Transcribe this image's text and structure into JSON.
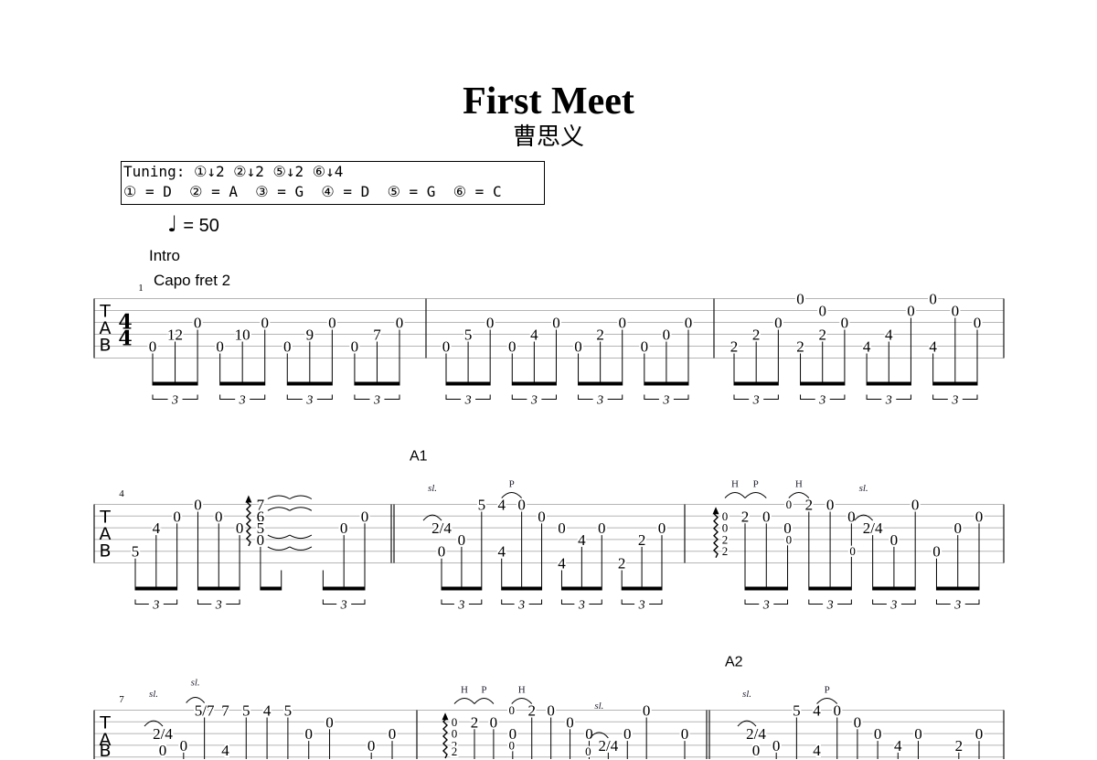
{
  "title": "First Meet",
  "artist": "曹思义",
  "tuning": {
    "line1": "Tuning: ①↓2 ②↓2 ⑤↓2 ⑥↓4",
    "line2": "① = D  ② = A  ③ = G  ④ = D  ⑤ = G  ⑥ = C"
  },
  "tempo": {
    "symbol": "♩",
    "text": "= 50"
  },
  "intro_label": "Intro",
  "capo": "Capo fret 2",
  "tab_clef": [
    "T",
    "A",
    "B"
  ],
  "time_signature": {
    "top": "4",
    "bottom": "4"
  },
  "triplet_label": "3",
  "systems": [
    {
      "measure_number": "1",
      "measures": [
        {
          "slots": [
            [
              [
                5,
                "0"
              ]
            ],
            [
              [
                4,
                "12"
              ]
            ],
            [
              [
                3,
                "0"
              ]
            ],
            [
              [
                5,
                "0"
              ]
            ],
            [
              [
                4,
                "10"
              ]
            ],
            [
              [
                3,
                "0"
              ]
            ],
            [
              [
                5,
                "0"
              ]
            ],
            [
              [
                4,
                "9"
              ]
            ],
            [
              [
                3,
                "0"
              ]
            ],
            [
              [
                5,
                "0"
              ]
            ],
            [
              [
                4,
                "7"
              ]
            ],
            [
              [
                3,
                "0"
              ]
            ]
          ]
        },
        {
          "slots": [
            [
              [
                5,
                "0"
              ]
            ],
            [
              [
                4,
                "5"
              ]
            ],
            [
              [
                3,
                "0"
              ]
            ],
            [
              [
                5,
                "0"
              ]
            ],
            [
              [
                4,
                "4"
              ]
            ],
            [
              [
                3,
                "0"
              ]
            ],
            [
              [
                5,
                "0"
              ]
            ],
            [
              [
                4,
                "2"
              ]
            ],
            [
              [
                3,
                "0"
              ]
            ],
            [
              [
                5,
                "0"
              ]
            ],
            [
              [
                4,
                "0"
              ]
            ],
            [
              [
                3,
                "0"
              ]
            ]
          ]
        },
        {
          "slots": [
            [
              [
                5,
                "2"
              ]
            ],
            [
              [
                4,
                "2"
              ]
            ],
            [
              [
                3,
                "0"
              ]
            ],
            [
              [
                1,
                "0"
              ],
              [
                5,
                "2"
              ]
            ],
            [
              [
                2,
                "0"
              ],
              [
                4,
                "2"
              ]
            ],
            [
              [
                3,
                "0"
              ]
            ],
            [
              [
                5,
                "4"
              ]
            ],
            [
              [
                4,
                "4"
              ]
            ],
            [
              [
                2,
                "0"
              ]
            ],
            [
              [
                1,
                "0"
              ],
              [
                5,
                "4"
              ]
            ],
            [
              [
                2,
                "0"
              ]
            ],
            [
              [
                3,
                "0"
              ]
            ]
          ]
        }
      ]
    },
    {
      "measure_number": "4",
      "measures": [
        {
          "slots": [
            [
              [
                5,
                "5"
              ]
            ],
            [
              [
                3,
                "4"
              ]
            ],
            [
              [
                2,
                "0"
              ]
            ],
            [
              [
                1,
                "0"
              ]
            ],
            [
              [
                2,
                "0"
              ]
            ],
            [
              [
                3,
                "0"
              ]
            ],
            {
              "n": [
                [
                  1,
                  "7"
                ],
                [
                  2,
                  "6"
                ],
                [
                  3,
                  "5"
                ],
                [
                  4,
                  "0"
                ]
              ],
              "arp": true,
              "ring": true
            },
            [],
            null,
            [],
            [
              [
                3,
                "0"
              ]
            ],
            [
              [
                2,
                "0"
              ]
            ]
          ],
          "triplets": [
            true,
            true,
            false,
            true
          ]
        },
        {
          "section": "A1",
          "slots": [
            [
              [
                3,
                "2/4"
              ],
              [
                5,
                "0"
              ]
            ],
            [
              [
                4,
                "0"
              ]
            ],
            [
              [
                1,
                "5"
              ]
            ],
            [
              [
                1,
                "4"
              ],
              [
                5,
                "4"
              ]
            ],
            [
              [
                1,
                "0"
              ]
            ],
            [
              [
                2,
                "0"
              ]
            ],
            [
              [
                3,
                "0"
              ],
              [
                6,
                "4"
              ]
            ],
            [
              [
                4,
                "4"
              ]
            ],
            [
              [
                3,
                "0"
              ]
            ],
            [
              [
                6,
                "2"
              ]
            ],
            [
              [
                4,
                "2"
              ]
            ],
            [
              [
                3,
                "0"
              ]
            ]
          ],
          "techs": [
            {
              "at": 0,
              "label": "sl."
            },
            {
              "at": 4,
              "label": "P"
            }
          ]
        },
        {
          "slots": [
            {
              "pre": [
                [
                  2,
                  "0"
                ],
                [
                  3,
                  "0"
                ],
                [
                  4,
                  "2"
                ],
                [
                  5,
                  "2"
                ]
              ],
              "arp": true,
              "n": [
                [
                  2,
                  "2"
                ]
              ]
            },
            [
              [
                2,
                "0"
              ]
            ],
            [
              [
                3,
                "0"
              ]
            ],
            {
              "pre": [
                [
                  1,
                  "0"
                ],
                [
                  4,
                  "0"
                ]
              ],
              "n": [
                [
                  1,
                  "2"
                ]
              ]
            },
            [
              [
                1,
                "0"
              ]
            ],
            [
              [
                2,
                "0"
              ]
            ],
            {
              "pre": [
                [
                  5,
                  "0"
                ]
              ],
              "n": [
                [
                  3,
                  "2/4"
                ]
              ]
            },
            [
              [
                4,
                "0"
              ]
            ],
            [
              [
                1,
                "0"
              ]
            ],
            [
              [
                5,
                "0"
              ]
            ],
            [
              [
                3,
                "0"
              ]
            ],
            [
              [
                2,
                "0"
              ]
            ]
          ],
          "techs": [
            {
              "at": 0,
              "label": "H"
            },
            {
              "at": 1,
              "label": "P"
            },
            {
              "at": 3,
              "label": "H"
            },
            {
              "at": 6,
              "label": "sl."
            }
          ]
        }
      ]
    },
    {
      "measure_number": "7",
      "measures": [
        {
          "slots": [
            [
              [
                3,
                "2/4"
              ],
              [
                5,
                "0"
              ]
            ],
            [
              [
                4,
                "0"
              ]
            ],
            [
              [
                1,
                "5/7"
              ]
            ],
            [
              [
                1,
                "7"
              ],
              [
                5,
                "4"
              ]
            ],
            [
              [
                1,
                "5"
              ]
            ],
            [
              [
                1,
                "4"
              ]
            ],
            [
              [
                1,
                "5"
              ]
            ],
            [
              [
                3,
                "0"
              ]
            ],
            [
              [
                2,
                "0"
              ]
            ],
            null,
            [
              [
                4,
                "0"
              ]
            ],
            [
              [
                3,
                "0"
              ]
            ]
          ],
          "techs": [
            {
              "at": 0,
              "label": "sl."
            },
            {
              "at": 2,
              "label": "sl."
            }
          ]
        },
        {
          "slots": [
            {
              "pre": [
                [
                  2,
                  "0"
                ],
                [
                  3,
                  "0"
                ],
                [
                  4,
                  "2"
                ],
                [
                  5,
                  "2"
                ]
              ],
              "arp": true,
              "n": [
                [
                  2,
                  "2"
                ]
              ]
            },
            [
              [
                2,
                "0"
              ]
            ],
            [
              [
                3,
                "0"
              ]
            ],
            {
              "pre": [
                [
                  1,
                  "0"
                ],
                [
                  4,
                  "0"
                ]
              ],
              "n": [
                [
                  1,
                  "2"
                ]
              ]
            },
            [
              [
                1,
                "0"
              ]
            ],
            [
              [
                2,
                "0"
              ]
            ],
            [
              [
                3,
                "0"
              ]
            ],
            {
              "pre": [
                [
                  5,
                  "0"
                ]
              ],
              "n": [
                [
                  4,
                  "2/4"
                ]
              ]
            },
            [
              [
                3,
                "0"
              ]
            ],
            [
              [
                1,
                "0"
              ]
            ],
            null,
            [
              [
                3,
                "0"
              ]
            ]
          ],
          "techs": [
            {
              "at": 0,
              "label": "H"
            },
            {
              "at": 1,
              "label": "P"
            },
            {
              "at": 3,
              "label": "H"
            },
            {
              "at": 7,
              "label": "sl."
            }
          ]
        },
        {
          "section": "A2",
          "slots": [
            [
              [
                3,
                "2/4"
              ],
              [
                5,
                "0"
              ]
            ],
            [
              [
                4,
                "0"
              ]
            ],
            [
              [
                1,
                "5"
              ]
            ],
            [
              [
                1,
                "4"
              ],
              [
                5,
                "4"
              ]
            ],
            [
              [
                1,
                "0"
              ]
            ],
            [
              [
                2,
                "0"
              ]
            ],
            [
              [
                3,
                "0"
              ]
            ],
            [
              [
                4,
                "4"
              ]
            ],
            [
              [
                3,
                "0"
              ]
            ],
            null,
            [
              [
                4,
                "2"
              ]
            ],
            [
              [
                3,
                "0"
              ]
            ]
          ],
          "techs": [
            {
              "at": 0,
              "label": "sl."
            },
            {
              "at": 4,
              "label": "P"
            }
          ]
        }
      ]
    }
  ]
}
